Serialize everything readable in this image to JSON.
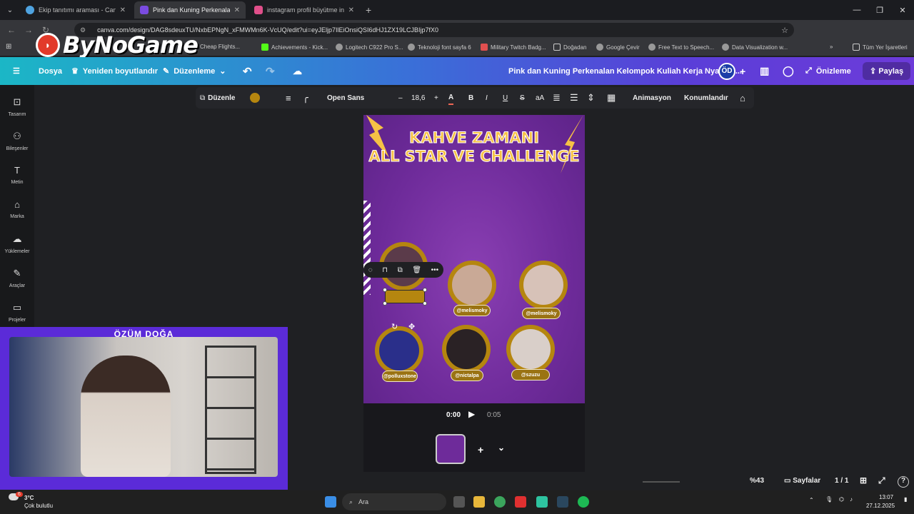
{
  "tabs": [
    {
      "title": "Ekip tanıtımı araması - Canva",
      "color": "#4fa3e0",
      "active": false
    },
    {
      "title": "Pink dan Kuning Perkenalan Ke",
      "color": "#7a4be0",
      "active": true
    },
    {
      "title": "instagram profil büyütme insta",
      "color": "#e04f8a",
      "active": false
    }
  ],
  "browser": {
    "url": "canva.com/design/DAG8sdeuxTU/NxbEPNgN_xFMWMn6K-VcUQ/edit?ui=eyJEljp7IlEiOnsiQSI6dHJ1ZX19LCJBIjp7fX0",
    "window_controls": [
      "—",
      "❐",
      "✕"
    ]
  },
  "bookmarks": [
    {
      "label": "Cheap Flights...",
      "color": "#888"
    },
    {
      "label": "Achievements - Kick...",
      "color": "#53fc18"
    },
    {
      "label": "Logitech C922 Pro S...",
      "color": "#ccc"
    },
    {
      "label": "Teknoloji font sayfa 6",
      "color": "#ccc"
    },
    {
      "label": "Military Twitch Badg...",
      "color": "#e04f4f"
    },
    {
      "label": "Doğadan",
      "color": "#ccc"
    },
    {
      "label": "Google Çevir",
      "color": "#ccc"
    },
    {
      "label": "Free Text to Speech...",
      "color": "#ccc"
    },
    {
      "label": "Data Visualization w...",
      "color": "#ccc"
    },
    {
      "label": "»",
      "color": "#ccc"
    },
    {
      "label": "Tüm Yer İşaretleri",
      "color": "#ccc"
    }
  ],
  "logo": {
    "text": "ByNoGame"
  },
  "canva_header": {
    "file": "Dosya",
    "resize": "Yeniden boyutlandır",
    "editing": "Düzenleme",
    "doc_title": "Pink dan Kuning Perkenalan Kelompok Kuliah Kerja Nyata In...",
    "user_initials": "ÖD",
    "preview": "Önizleme",
    "share": "Paylaş"
  },
  "left_rail": [
    {
      "label": "Tasarım",
      "icon": "⊡"
    },
    {
      "label": "Bileşenler",
      "icon": "⚇"
    },
    {
      "label": "Metin",
      "icon": "T"
    },
    {
      "label": "Marka",
      "icon": "⌂"
    },
    {
      "label": "Yüklemeler",
      "icon": "☁"
    },
    {
      "label": "Araçlar",
      "icon": "✎"
    },
    {
      "label": "Projeler",
      "icon": "▭"
    }
  ],
  "toolbar": {
    "edit": "Düzenle",
    "font": "Open Sans",
    "minus": "–",
    "font_size": "18,6",
    "plus": "+",
    "bold": "B",
    "italic": "I",
    "underline": "U",
    "strike": "S",
    "case": "aA",
    "animation": "Animasyon",
    "position": "Konumlandır",
    "color": "#b5860f"
  },
  "design": {
    "headline_line1": "KAHVE ZAMANI",
    "headline_line2": "ALL STAR VE CHALLENGE",
    "handles_row1": [
      "",
      "@melismoky",
      "@melismoky"
    ],
    "handles_row2": [
      "@polluxstone",
      "@nictalpa",
      "@szuzu"
    ],
    "photo_colors": [
      "#5b3b4a",
      "#c9a996",
      "#d7c2b8",
      "#2a2f8a",
      "#2a2225",
      "#d9cfc9"
    ]
  },
  "timeline": {
    "current": "0:00",
    "total": "0:05",
    "add": "+",
    "expand": "⌄"
  },
  "bottom_bar": {
    "zoom": "%43",
    "pages_label": "Sayfalar",
    "page_count": "1 / 1",
    "help": "?"
  },
  "webcam": {
    "name": "ÖZÜM DOĞA"
  },
  "taskbar": {
    "weather_temp": "3°C",
    "weather_desc": "Çok bulutlu",
    "badge": "6",
    "search": "Ara",
    "time": "13:07",
    "date": "27.12.2025"
  }
}
